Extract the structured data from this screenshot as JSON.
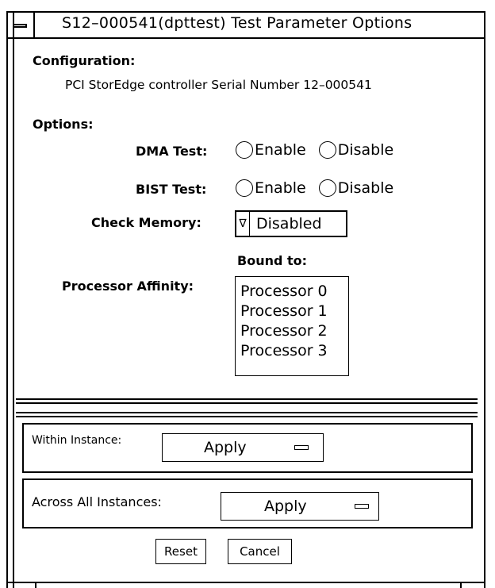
{
  "window": {
    "title": "S12–000541(dpttest) Test Parameter Options"
  },
  "configuration": {
    "heading": "Configuration:",
    "text": "PCI StorEdge controller Serial Number 12–000541"
  },
  "options": {
    "heading": "Options:",
    "dma_test": {
      "label": "DMA Test:",
      "enable": "Enable",
      "disable": "Disable"
    },
    "bist_test": {
      "label": "BIST Test:",
      "enable": "Enable",
      "disable": "Disable"
    },
    "check_memory": {
      "label": "Check Memory:",
      "value": "Disabled",
      "arrow_glyph": "∇"
    },
    "processor_affinity": {
      "label": "Processor Affinity:",
      "bound_to": "Bound to:",
      "items": [
        "Processor 0",
        "Processor 1",
        "Processor 2",
        "Processor 3"
      ]
    }
  },
  "apply": {
    "within_instance_label": "Within Instance:",
    "within_instance_button": "Apply",
    "across_instances_label": "Across All Instances:",
    "across_instances_button": "Apply"
  },
  "buttons": {
    "reset": "Reset",
    "cancel": "Cancel"
  }
}
